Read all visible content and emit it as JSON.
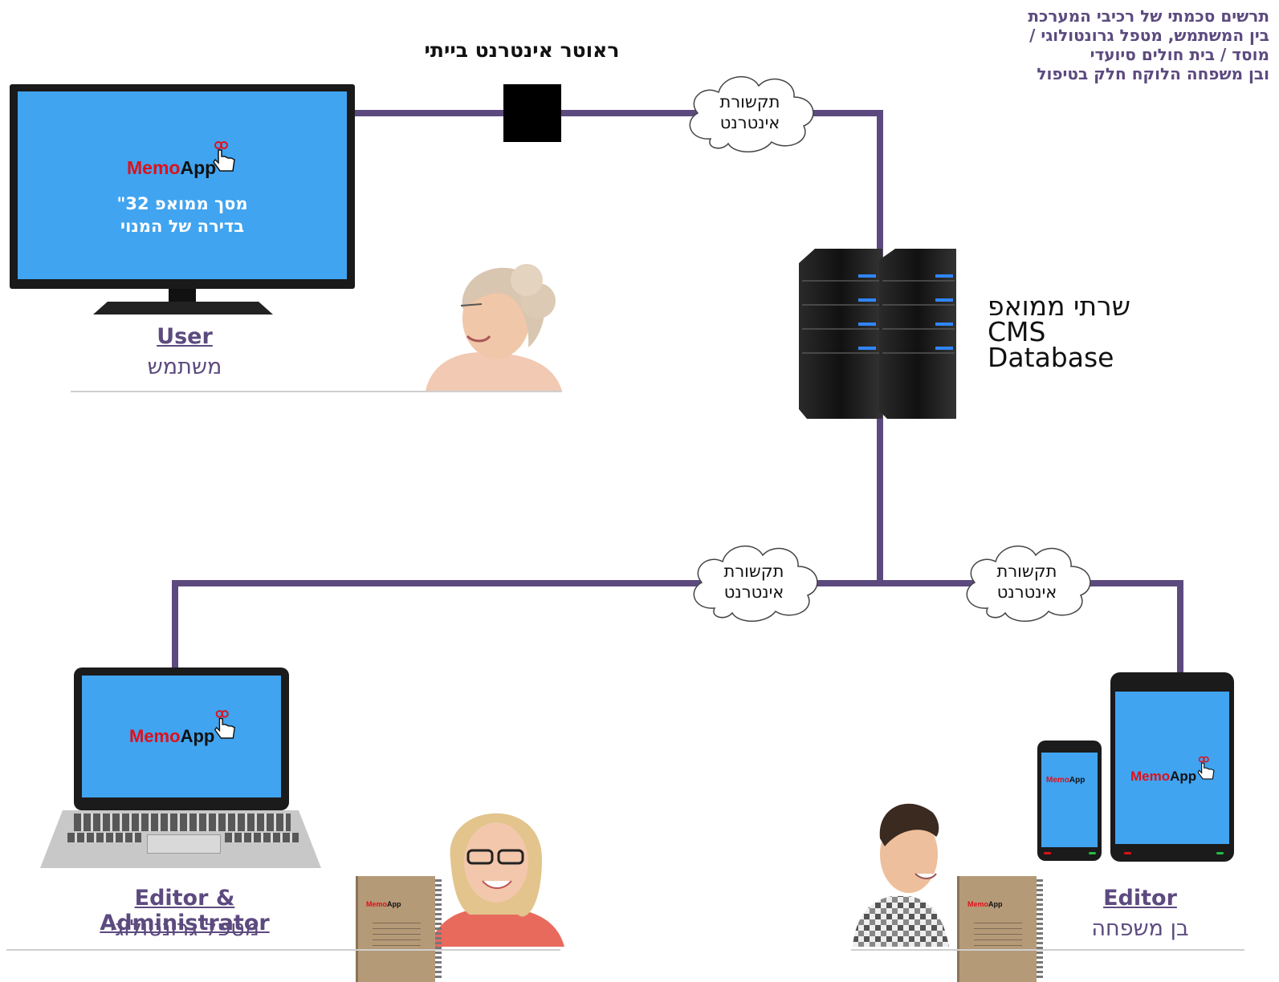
{
  "title_lines": [
    "תרשים סכמתי של רכיבי המערכת",
    "בין המשתמש, מטפל גרונטולוגי /",
    "מוסד / בית חולים סיועדי",
    "ובן משפחה הלוקח חלק בטיפול"
  ],
  "router": {
    "label": "ראוטר אינטרנט בייתי"
  },
  "internet_clouds": [
    {
      "line1": "תקשורת",
      "line2": "אינטרנט"
    },
    {
      "line1": "תקשורת",
      "line2": "אינטרנט"
    },
    {
      "line1": "תקשורת",
      "line2": "אינטרנט"
    }
  ],
  "logo": {
    "part1": "Memo",
    "part2": "App"
  },
  "tv": {
    "line1": "מסך ממואפ  32\"",
    "line2": "בדירה של המנוי"
  },
  "server": {
    "line1": "שרתי ממואפ",
    "line2": "CMS",
    "line3": "Database"
  },
  "user": {
    "en": "User",
    "he": "משתמש"
  },
  "admin": {
    "en": "Editor & Administrator",
    "he": "מטפל גרונטולוגי"
  },
  "editor": {
    "en": "Editor",
    "he": "בן משפחה"
  },
  "colors": {
    "wire": "#5c4a7f",
    "screen": "#40a4f0",
    "label": "#5c4a7f",
    "logo_red": "#e0101a"
  }
}
